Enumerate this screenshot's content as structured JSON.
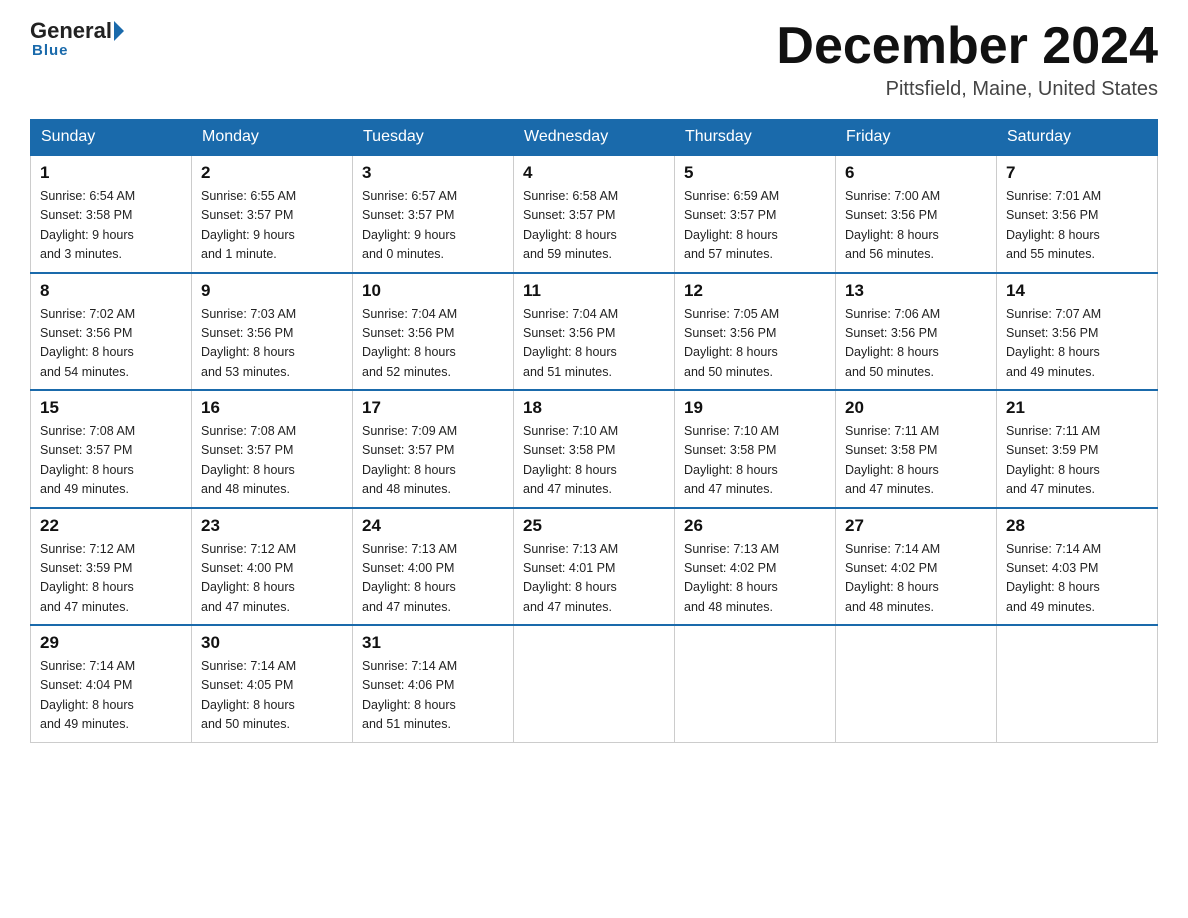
{
  "header": {
    "logo": {
      "general": "General",
      "arrow": "",
      "blue": "Blue"
    },
    "title": "December 2024",
    "location": "Pittsfield, Maine, United States"
  },
  "days_of_week": [
    "Sunday",
    "Monday",
    "Tuesday",
    "Wednesday",
    "Thursday",
    "Friday",
    "Saturday"
  ],
  "weeks": [
    [
      {
        "day": "1",
        "sunrise": "Sunrise: 6:54 AM",
        "sunset": "Sunset: 3:58 PM",
        "daylight": "Daylight: 9 hours",
        "daylight2": "and 3 minutes."
      },
      {
        "day": "2",
        "sunrise": "Sunrise: 6:55 AM",
        "sunset": "Sunset: 3:57 PM",
        "daylight": "Daylight: 9 hours",
        "daylight2": "and 1 minute."
      },
      {
        "day": "3",
        "sunrise": "Sunrise: 6:57 AM",
        "sunset": "Sunset: 3:57 PM",
        "daylight": "Daylight: 9 hours",
        "daylight2": "and 0 minutes."
      },
      {
        "day": "4",
        "sunrise": "Sunrise: 6:58 AM",
        "sunset": "Sunset: 3:57 PM",
        "daylight": "Daylight: 8 hours",
        "daylight2": "and 59 minutes."
      },
      {
        "day": "5",
        "sunrise": "Sunrise: 6:59 AM",
        "sunset": "Sunset: 3:57 PM",
        "daylight": "Daylight: 8 hours",
        "daylight2": "and 57 minutes."
      },
      {
        "day": "6",
        "sunrise": "Sunrise: 7:00 AM",
        "sunset": "Sunset: 3:56 PM",
        "daylight": "Daylight: 8 hours",
        "daylight2": "and 56 minutes."
      },
      {
        "day": "7",
        "sunrise": "Sunrise: 7:01 AM",
        "sunset": "Sunset: 3:56 PM",
        "daylight": "Daylight: 8 hours",
        "daylight2": "and 55 minutes."
      }
    ],
    [
      {
        "day": "8",
        "sunrise": "Sunrise: 7:02 AM",
        "sunset": "Sunset: 3:56 PM",
        "daylight": "Daylight: 8 hours",
        "daylight2": "and 54 minutes."
      },
      {
        "day": "9",
        "sunrise": "Sunrise: 7:03 AM",
        "sunset": "Sunset: 3:56 PM",
        "daylight": "Daylight: 8 hours",
        "daylight2": "and 53 minutes."
      },
      {
        "day": "10",
        "sunrise": "Sunrise: 7:04 AM",
        "sunset": "Sunset: 3:56 PM",
        "daylight": "Daylight: 8 hours",
        "daylight2": "and 52 minutes."
      },
      {
        "day": "11",
        "sunrise": "Sunrise: 7:04 AM",
        "sunset": "Sunset: 3:56 PM",
        "daylight": "Daylight: 8 hours",
        "daylight2": "and 51 minutes."
      },
      {
        "day": "12",
        "sunrise": "Sunrise: 7:05 AM",
        "sunset": "Sunset: 3:56 PM",
        "daylight": "Daylight: 8 hours",
        "daylight2": "and 50 minutes."
      },
      {
        "day": "13",
        "sunrise": "Sunrise: 7:06 AM",
        "sunset": "Sunset: 3:56 PM",
        "daylight": "Daylight: 8 hours",
        "daylight2": "and 50 minutes."
      },
      {
        "day": "14",
        "sunrise": "Sunrise: 7:07 AM",
        "sunset": "Sunset: 3:56 PM",
        "daylight": "Daylight: 8 hours",
        "daylight2": "and 49 minutes."
      }
    ],
    [
      {
        "day": "15",
        "sunrise": "Sunrise: 7:08 AM",
        "sunset": "Sunset: 3:57 PM",
        "daylight": "Daylight: 8 hours",
        "daylight2": "and 49 minutes."
      },
      {
        "day": "16",
        "sunrise": "Sunrise: 7:08 AM",
        "sunset": "Sunset: 3:57 PM",
        "daylight": "Daylight: 8 hours",
        "daylight2": "and 48 minutes."
      },
      {
        "day": "17",
        "sunrise": "Sunrise: 7:09 AM",
        "sunset": "Sunset: 3:57 PM",
        "daylight": "Daylight: 8 hours",
        "daylight2": "and 48 minutes."
      },
      {
        "day": "18",
        "sunrise": "Sunrise: 7:10 AM",
        "sunset": "Sunset: 3:58 PM",
        "daylight": "Daylight: 8 hours",
        "daylight2": "and 47 minutes."
      },
      {
        "day": "19",
        "sunrise": "Sunrise: 7:10 AM",
        "sunset": "Sunset: 3:58 PM",
        "daylight": "Daylight: 8 hours",
        "daylight2": "and 47 minutes."
      },
      {
        "day": "20",
        "sunrise": "Sunrise: 7:11 AM",
        "sunset": "Sunset: 3:58 PM",
        "daylight": "Daylight: 8 hours",
        "daylight2": "and 47 minutes."
      },
      {
        "day": "21",
        "sunrise": "Sunrise: 7:11 AM",
        "sunset": "Sunset: 3:59 PM",
        "daylight": "Daylight: 8 hours",
        "daylight2": "and 47 minutes."
      }
    ],
    [
      {
        "day": "22",
        "sunrise": "Sunrise: 7:12 AM",
        "sunset": "Sunset: 3:59 PM",
        "daylight": "Daylight: 8 hours",
        "daylight2": "and 47 minutes."
      },
      {
        "day": "23",
        "sunrise": "Sunrise: 7:12 AM",
        "sunset": "Sunset: 4:00 PM",
        "daylight": "Daylight: 8 hours",
        "daylight2": "and 47 minutes."
      },
      {
        "day": "24",
        "sunrise": "Sunrise: 7:13 AM",
        "sunset": "Sunset: 4:00 PM",
        "daylight": "Daylight: 8 hours",
        "daylight2": "and 47 minutes."
      },
      {
        "day": "25",
        "sunrise": "Sunrise: 7:13 AM",
        "sunset": "Sunset: 4:01 PM",
        "daylight": "Daylight: 8 hours",
        "daylight2": "and 47 minutes."
      },
      {
        "day": "26",
        "sunrise": "Sunrise: 7:13 AM",
        "sunset": "Sunset: 4:02 PM",
        "daylight": "Daylight: 8 hours",
        "daylight2": "and 48 minutes."
      },
      {
        "day": "27",
        "sunrise": "Sunrise: 7:14 AM",
        "sunset": "Sunset: 4:02 PM",
        "daylight": "Daylight: 8 hours",
        "daylight2": "and 48 minutes."
      },
      {
        "day": "28",
        "sunrise": "Sunrise: 7:14 AM",
        "sunset": "Sunset: 4:03 PM",
        "daylight": "Daylight: 8 hours",
        "daylight2": "and 49 minutes."
      }
    ],
    [
      {
        "day": "29",
        "sunrise": "Sunrise: 7:14 AM",
        "sunset": "Sunset: 4:04 PM",
        "daylight": "Daylight: 8 hours",
        "daylight2": "and 49 minutes."
      },
      {
        "day": "30",
        "sunrise": "Sunrise: 7:14 AM",
        "sunset": "Sunset: 4:05 PM",
        "daylight": "Daylight: 8 hours",
        "daylight2": "and 50 minutes."
      },
      {
        "day": "31",
        "sunrise": "Sunrise: 7:14 AM",
        "sunset": "Sunset: 4:06 PM",
        "daylight": "Daylight: 8 hours",
        "daylight2": "and 51 minutes."
      },
      {
        "day": "",
        "sunrise": "",
        "sunset": "",
        "daylight": "",
        "daylight2": ""
      },
      {
        "day": "",
        "sunrise": "",
        "sunset": "",
        "daylight": "",
        "daylight2": ""
      },
      {
        "day": "",
        "sunrise": "",
        "sunset": "",
        "daylight": "",
        "daylight2": ""
      },
      {
        "day": "",
        "sunrise": "",
        "sunset": "",
        "daylight": "",
        "daylight2": ""
      }
    ]
  ]
}
